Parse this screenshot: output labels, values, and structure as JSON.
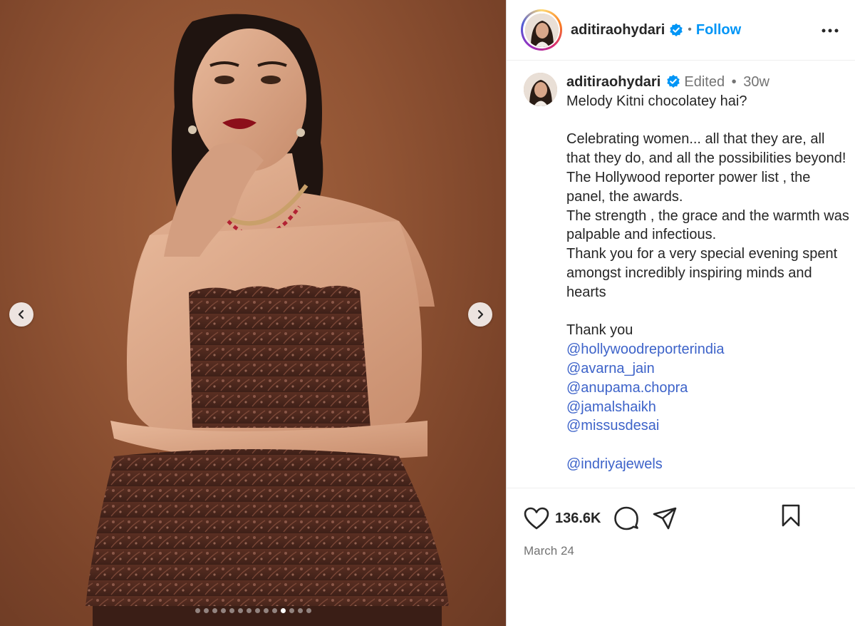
{
  "post": {
    "username": "aditiraohydari",
    "verified": true,
    "follow_label": "Follow",
    "bullet": "•",
    "edited_label": "Edited",
    "age": "30w",
    "caption": "Melody Kitni chocolatey hai?\n\nCelebrating women... all that they are, all that they do, and all the possibilities beyond!\nThe Hollywood reporter power list , the panel, the awards.\nThe strength , the grace and the warmth was palpable and infectious.\nThank you for a very special evening spent amongst incredibly inspiring minds and hearts\n\nThank you",
    "mentions": [
      " @hollywoodreporterindia",
      "@avarna_jain",
      "@anupama.chopra",
      "@jamalshaikh",
      "@missusdesai",
      "",
      "@indriyajewels"
    ],
    "likes": "136.6K",
    "date": "March 24"
  },
  "carousel": {
    "total": 14,
    "active_index": 10,
    "prev_icon": "chevron-left-icon",
    "next_icon": "chevron-right-icon"
  },
  "icons": {
    "more": "more-horizontal-icon",
    "like": "heart-icon",
    "comment": "comment-icon",
    "share": "send-icon",
    "save": "bookmark-icon",
    "verified": "verified-badge-icon"
  },
  "colors": {
    "follow": "#0095f6",
    "mention": "#3d63c9",
    "verified": "#0095f6",
    "backdrop": "#915434"
  }
}
